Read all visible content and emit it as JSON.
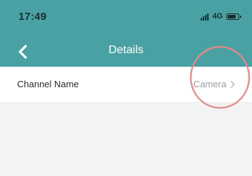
{
  "status_bar": {
    "time": "17:49",
    "network": "4G",
    "icons": [
      "signal-icon",
      "battery-icon"
    ]
  },
  "nav_bar": {
    "title": "Details",
    "back_icon": "chevron-left-icon"
  },
  "details": {
    "rows": [
      {
        "label": "Channel Name",
        "value": "Camera",
        "trailing_icon": "chevron-right-icon"
      }
    ]
  },
  "colors": {
    "header_teal": "#4aa1a3",
    "background": "#f3f3f3",
    "row_background": "#ffffff",
    "label_text": "#2b2b2b",
    "value_text": "#9b9b9b",
    "annotation_red": "#e08a8a"
  }
}
